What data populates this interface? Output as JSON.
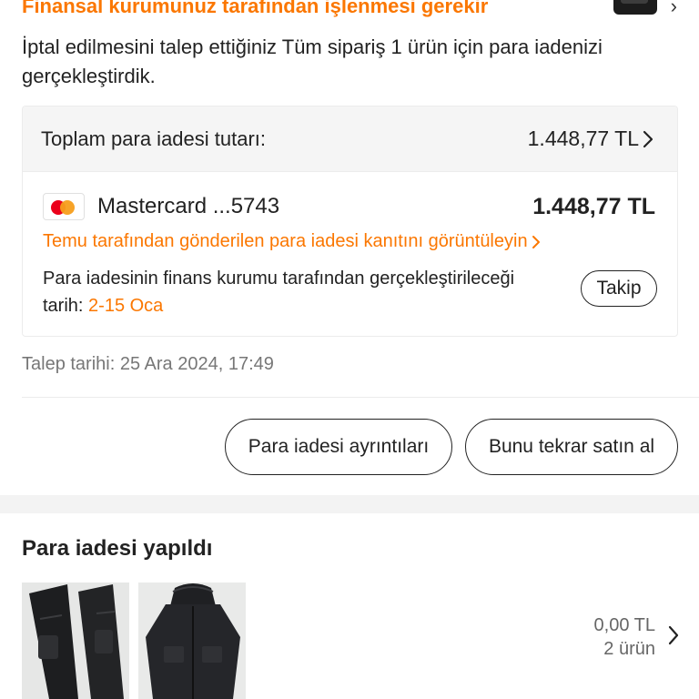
{
  "status": {
    "heading": "Finansal kurumunuz tarafından işlenmesi gerekir",
    "message": "İptal edilmesini talep ettiğiniz Tüm sipariş 1 ürün için para iadenizi gerçekleştirdik."
  },
  "refund": {
    "total_label": "Toplam para iadesi tutarı:",
    "total_amount": "1.448,77 TL",
    "payment_method": "Mastercard ...5743",
    "payment_amount": "1.448,77 TL",
    "proof_link": "Temu tarafından gönderilen para iadesi kanıtını görüntüleyin",
    "eta_text": "Para iadesinin finans kurumu tarafından gerçekleştirileceği tarih:",
    "eta_date": "2-15 Oca",
    "track_button": "Takip"
  },
  "request_date": "Talep tarihi: 25 Ara 2024, 17:49",
  "actions": {
    "details_button": "Para iadesi ayrıntıları",
    "rebuy_button": "Bunu tekrar satın al"
  },
  "refunded_section": {
    "title": "Para iadesi yapıldı",
    "amount": "0,00 TL",
    "item_count": "2 ürün",
    "items": [
      {
        "image": "black-cargo-pants"
      },
      {
        "image": "black-hooded-jacket"
      }
    ]
  },
  "colors": {
    "accent": "#fb7701",
    "mastercard_red": "#eb001b",
    "mastercard_orange": "#f79e1b"
  },
  "icons": [
    "chevron-right-icon",
    "mastercard-logo-icon"
  ]
}
